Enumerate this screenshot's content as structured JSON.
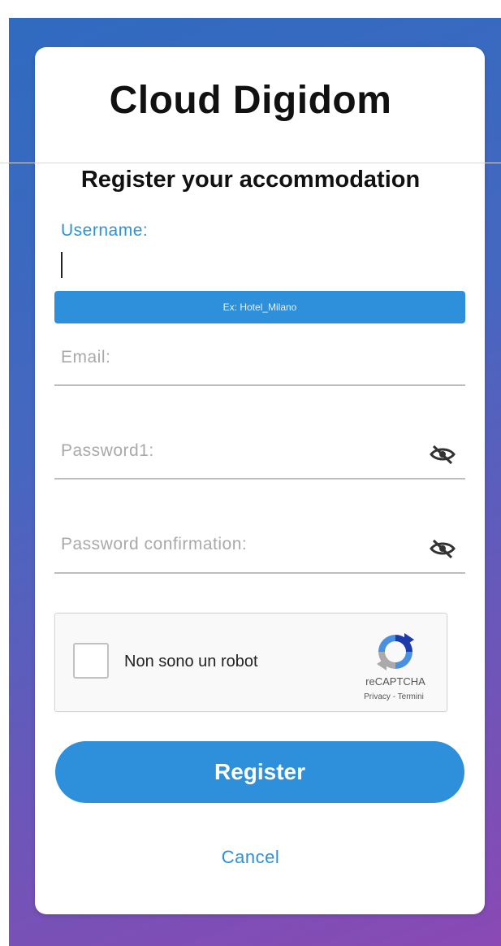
{
  "app": {
    "title": "Cloud Digidom"
  },
  "form": {
    "subtitle": "Register your accommodation",
    "username": {
      "label": "Username:",
      "value": "",
      "hint": "Ex: Hotel_Milano"
    },
    "email": {
      "placeholder": "Email:"
    },
    "password": {
      "placeholder": "Password1:",
      "toggle_icon": "eye-slash-icon"
    },
    "password_confirmation": {
      "placeholder": "Password confirmation:",
      "toggle_icon": "eye-slash-icon"
    }
  },
  "captcha": {
    "label": "Non sono un robot",
    "brand": "reCAPTCHA",
    "links": "Privacy - Termini",
    "checked": false
  },
  "actions": {
    "register_label": "Register",
    "cancel_label": "Cancel"
  },
  "colors": {
    "accent": "#2e8fda",
    "gradient_start": "#2f6bc0",
    "gradient_end": "#8a49b4"
  }
}
